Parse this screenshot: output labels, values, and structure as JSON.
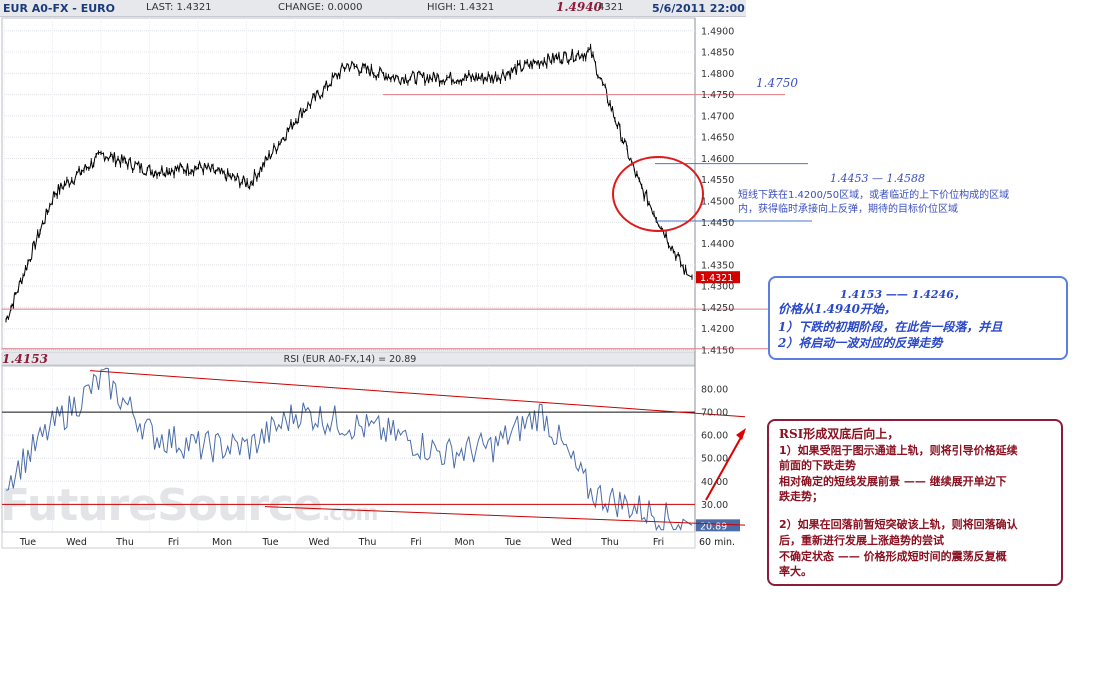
{
  "header": {
    "symbol": "EUR A0-FX - EURO",
    "last": "LAST: 1.4321",
    "change": "CHANGE: 0.0000",
    "high": "HIGH: 1.4321",
    "high_annot": "1.4940",
    "high_tail": "4321",
    "datetime": "5/6/2011 22:00"
  },
  "watermark": {
    "text": "FutureSource",
    "suffix": ".com"
  },
  "price_panel": {
    "y_ticks": [
      "1.4900",
      "1.4850",
      "1.4800",
      "1.4750",
      "1.4700",
      "1.4650",
      "1.4600",
      "1.4550",
      "1.4500",
      "1.4450",
      "1.4400",
      "1.4350",
      "1.4300",
      "1.4250",
      "1.4200",
      "1.4150"
    ],
    "last_price_label": "1.4321",
    "low_annot": "1.4153"
  },
  "rsi_panel": {
    "title": "RSI (EUR A0-FX,14) = 20.89",
    "y_ticks": [
      "80.00",
      "70.00",
      "60.00",
      "50.00",
      "40.00",
      "30.00"
    ],
    "last_value_label": "20.89"
  },
  "x_axis": {
    "labels": [
      "Tue",
      "Wed",
      "Thu",
      "Fri",
      "Mon",
      "Tue",
      "Wed",
      "Thu",
      "Fri",
      "Mon",
      "Tue",
      "Wed",
      "Thu",
      "Fri"
    ],
    "interval": "60 min."
  },
  "annotations": {
    "level_1": "1.4750",
    "range_1": "1.4453 — 1.4588",
    "note_1_line1": "短线下跌在1.4200/50区域，或者临近的上下价位构成的区域",
    "note_1_line2": "内，获得临时承接向上反弹，期待的目标价位区域",
    "blue_box": {
      "line1": "1.4153 —— 1.4246，",
      "line2": "价格从1.4940开始，",
      "line3": "1）下跌的初期阶段，在此告一段落，并且",
      "line4": "2）将启动一波对应的反弹走势"
    },
    "red_box": {
      "line1": "RSI形成双底后向上，",
      "line2": "1）如果受阻于图示通道上轨，则将引导价格延续",
      "line3": "前面的下跌走势",
      "line4": "相对确定的短线发展前景 —— 继续展开单边下",
      "line5": "跌走势；",
      "line6": "2）如果在回落前暂短突破该上轨，则将回落确认",
      "line7": "后，重新进行发展上涨趋势的尝试",
      "line8": "不确定状态 —— 价格形成短时间的震荡反复概",
      "line9": "率大。"
    }
  },
  "chart_data": [
    {
      "type": "line",
      "x": [
        "Tue",
        "Wed",
        "Thu",
        "Fri",
        "Mon",
        "Tue",
        "Wed",
        "Thu",
        "Fri",
        "Mon",
        "Tue",
        "Wed",
        "Thu",
        "Fri"
      ],
      "y": [
        1.422,
        1.452,
        1.461,
        1.457,
        1.458,
        1.454,
        1.47,
        1.482,
        1.479,
        1.479,
        1.479,
        1.483,
        1.485,
        1.454
      ],
      "last": 1.4321,
      "ylim": [
        1.415,
        1.493
      ],
      "levels": [
        1.475,
        1.4588,
        1.4453,
        1.4246,
        1.4153
      ],
      "grid": true
    },
    {
      "type": "line",
      "title": "RSI (EUR A0-FX,14) = 20.89",
      "y": [
        40,
        65,
        85,
        60,
        55,
        55,
        70,
        65,
        60,
        52,
        55,
        70,
        35,
        28
      ],
      "last": 20.89,
      "ylim": [
        18,
        90
      ],
      "levels": [
        70,
        30
      ],
      "grid": true
    }
  ]
}
